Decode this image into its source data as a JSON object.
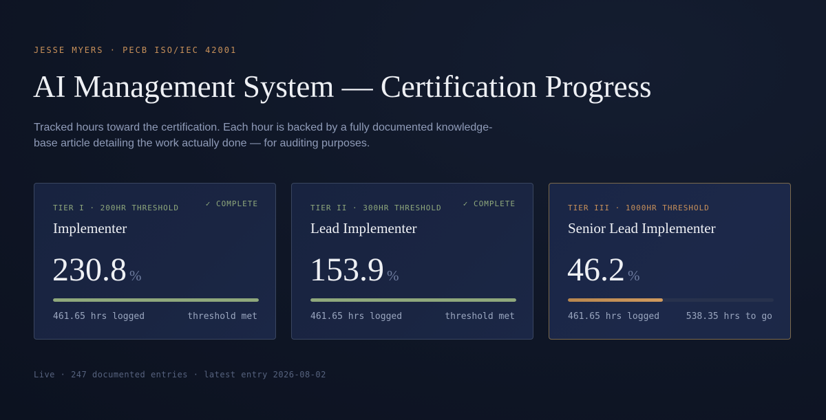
{
  "header": {
    "eyebrow": "JESSE MYERS · PECB ISO/IEC 42001",
    "title": "AI Management System — Certification Progress",
    "subtitle": "Tracked hours toward the certification. Each hour is backed by a fully documented knowledge-base article detailing the work actually done — for auditing purposes."
  },
  "cards": [
    {
      "tier": "TIER I · 200HR THRESHOLD",
      "status": "✓ COMPLETE",
      "name": "Implementer",
      "percent": "230.8",
      "unit": "%",
      "progress_fraction": 1.0,
      "logged": "461.65 hrs logged",
      "note": "threshold met",
      "accent": "#8fa87c"
    },
    {
      "tier": "TIER II · 300HR THRESHOLD",
      "status": "✓ COMPLETE",
      "name": "Lead Implementer",
      "percent": "153.9",
      "unit": "%",
      "progress_fraction": 1.0,
      "logged": "461.65 hrs logged",
      "note": "threshold met",
      "accent": "#8fa87c"
    },
    {
      "tier": "TIER III · 1000HR THRESHOLD",
      "status": "",
      "name": "Senior Lead Implementer",
      "percent": "46.2",
      "unit": "%",
      "progress_fraction": 0.462,
      "logged": "461.65 hrs logged",
      "note": "538.35 hrs to go",
      "accent": "#c9915a"
    }
  ],
  "footer": {
    "text": "Live · 247 documented entries · latest entry 2026-08-02"
  }
}
